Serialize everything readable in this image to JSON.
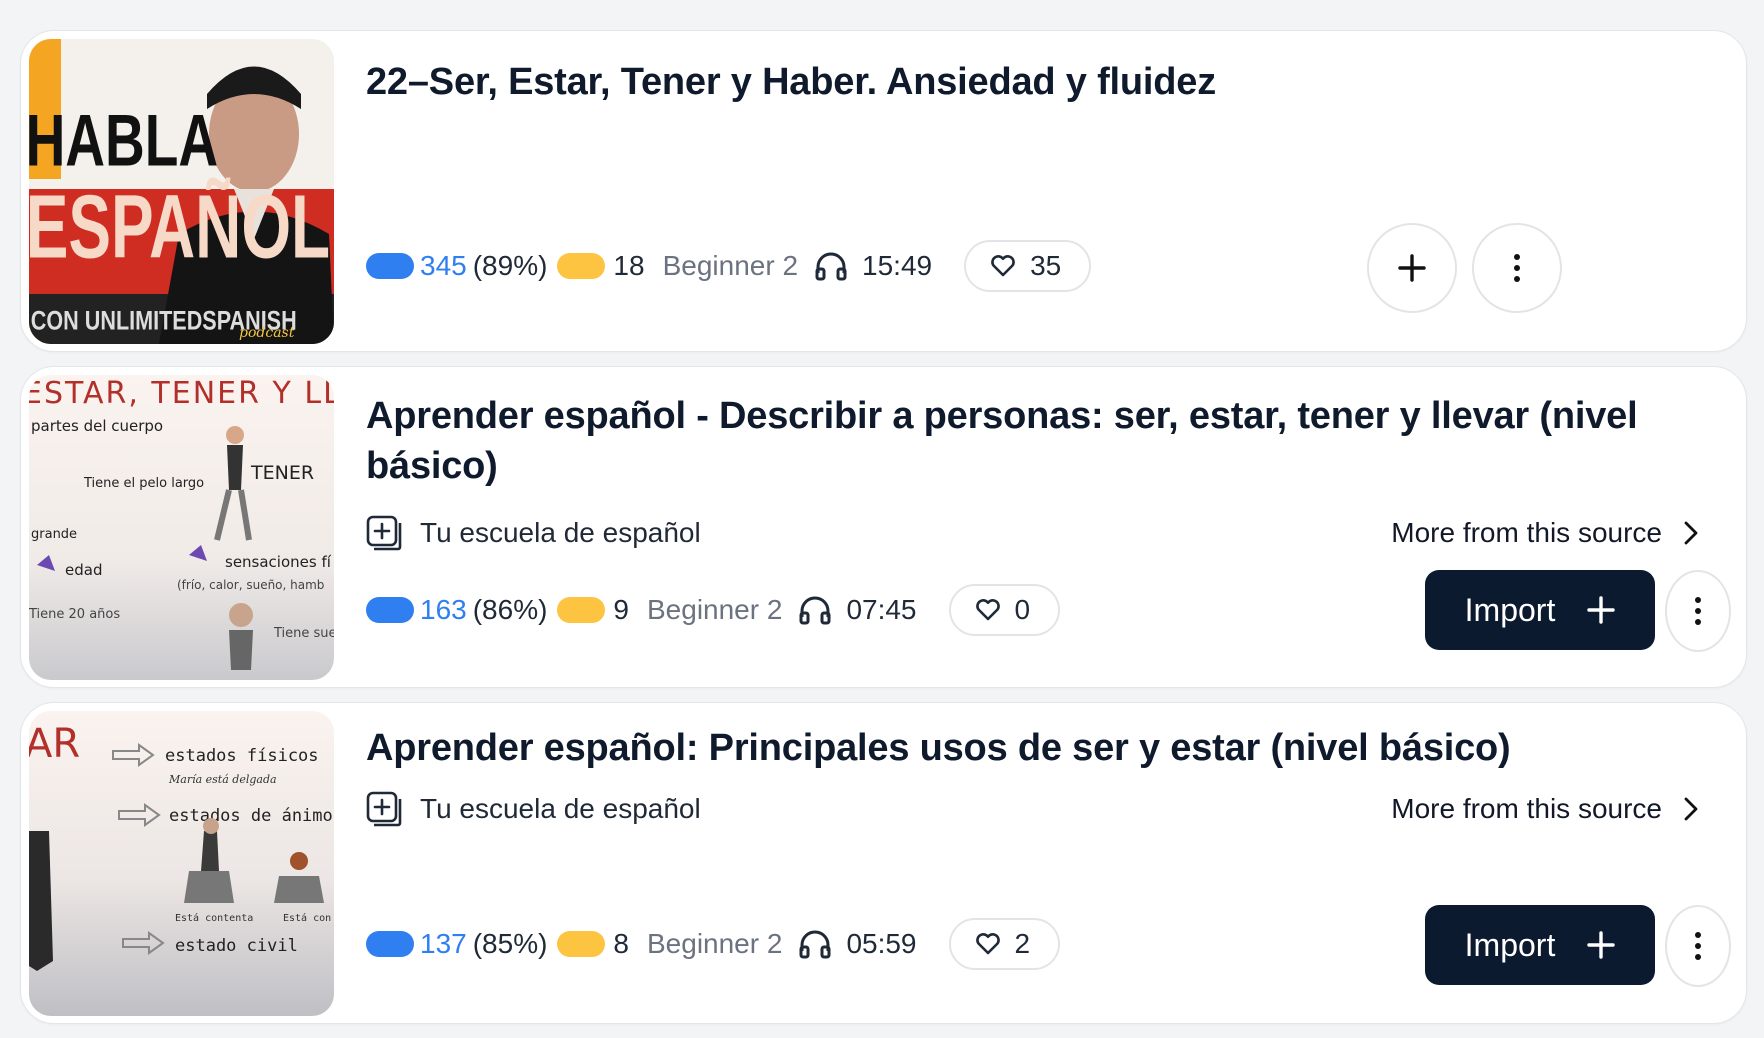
{
  "lessons": [
    {
      "title": "22–Ser, Estar, Tener y Haber. Ansiedad y fluidez",
      "known_words": "345",
      "known_pct": "(89%)",
      "lingqs": "18",
      "level": "Beginner 2",
      "duration": "15:49",
      "likes": "35",
      "thumb": {
        "line1": "HABLA",
        "line2": "ESPAÑOL",
        "line3": "CON UNLIMITEDSPANISH",
        "line4": "podcast"
      }
    },
    {
      "title": "Aprender español - Describir a personas: ser, estar, tener y llevar (nivel básico)",
      "source": "Tu escuela de español",
      "more": "More from this source",
      "known_words": "163",
      "known_pct": "(86%)",
      "lingqs": "9",
      "level": "Beginner 2",
      "duration": "07:45",
      "likes": "0",
      "import_label": "Import",
      "thumb": {
        "heading": "ESTAR, TENER Y LL",
        "t1": "partes del cuerpo",
        "t2": "Tiene el pelo largo",
        "t3": "TENER",
        "t4": "grande",
        "t5": "edad",
        "t6": "sensaciones fí",
        "t7": "(frío, calor, sueño, hamb",
        "t8": "Tiene 20 años",
        "t9": "Tiene sue"
      }
    },
    {
      "title": "Aprender español: Principales usos de ser y estar (nivel básico)",
      "source": "Tu escuela de español",
      "more": "More from this source",
      "known_words": "137",
      "known_pct": "(85%)",
      "lingqs": "8",
      "level": "Beginner 2",
      "duration": "05:59",
      "likes": "2",
      "import_label": "Import",
      "thumb": {
        "heading": "AR",
        "t1": "estados físicos",
        "t2": "María está delgada",
        "t3": "estados de ánimo",
        "t4": "Está contenta",
        "t5": "Está con",
        "t6": "estado civil"
      }
    }
  ],
  "colors": {
    "known": "#2f7ff0",
    "lingq": "#fcc440",
    "import_bg": "#0c1a30"
  },
  "icons": {
    "headphones": "headphones-icon",
    "heart": "heart-icon",
    "plus": "plus-icon",
    "more": "more-vertical-icon",
    "chevron": "chevron-right-icon",
    "source": "source-plus-icon"
  }
}
